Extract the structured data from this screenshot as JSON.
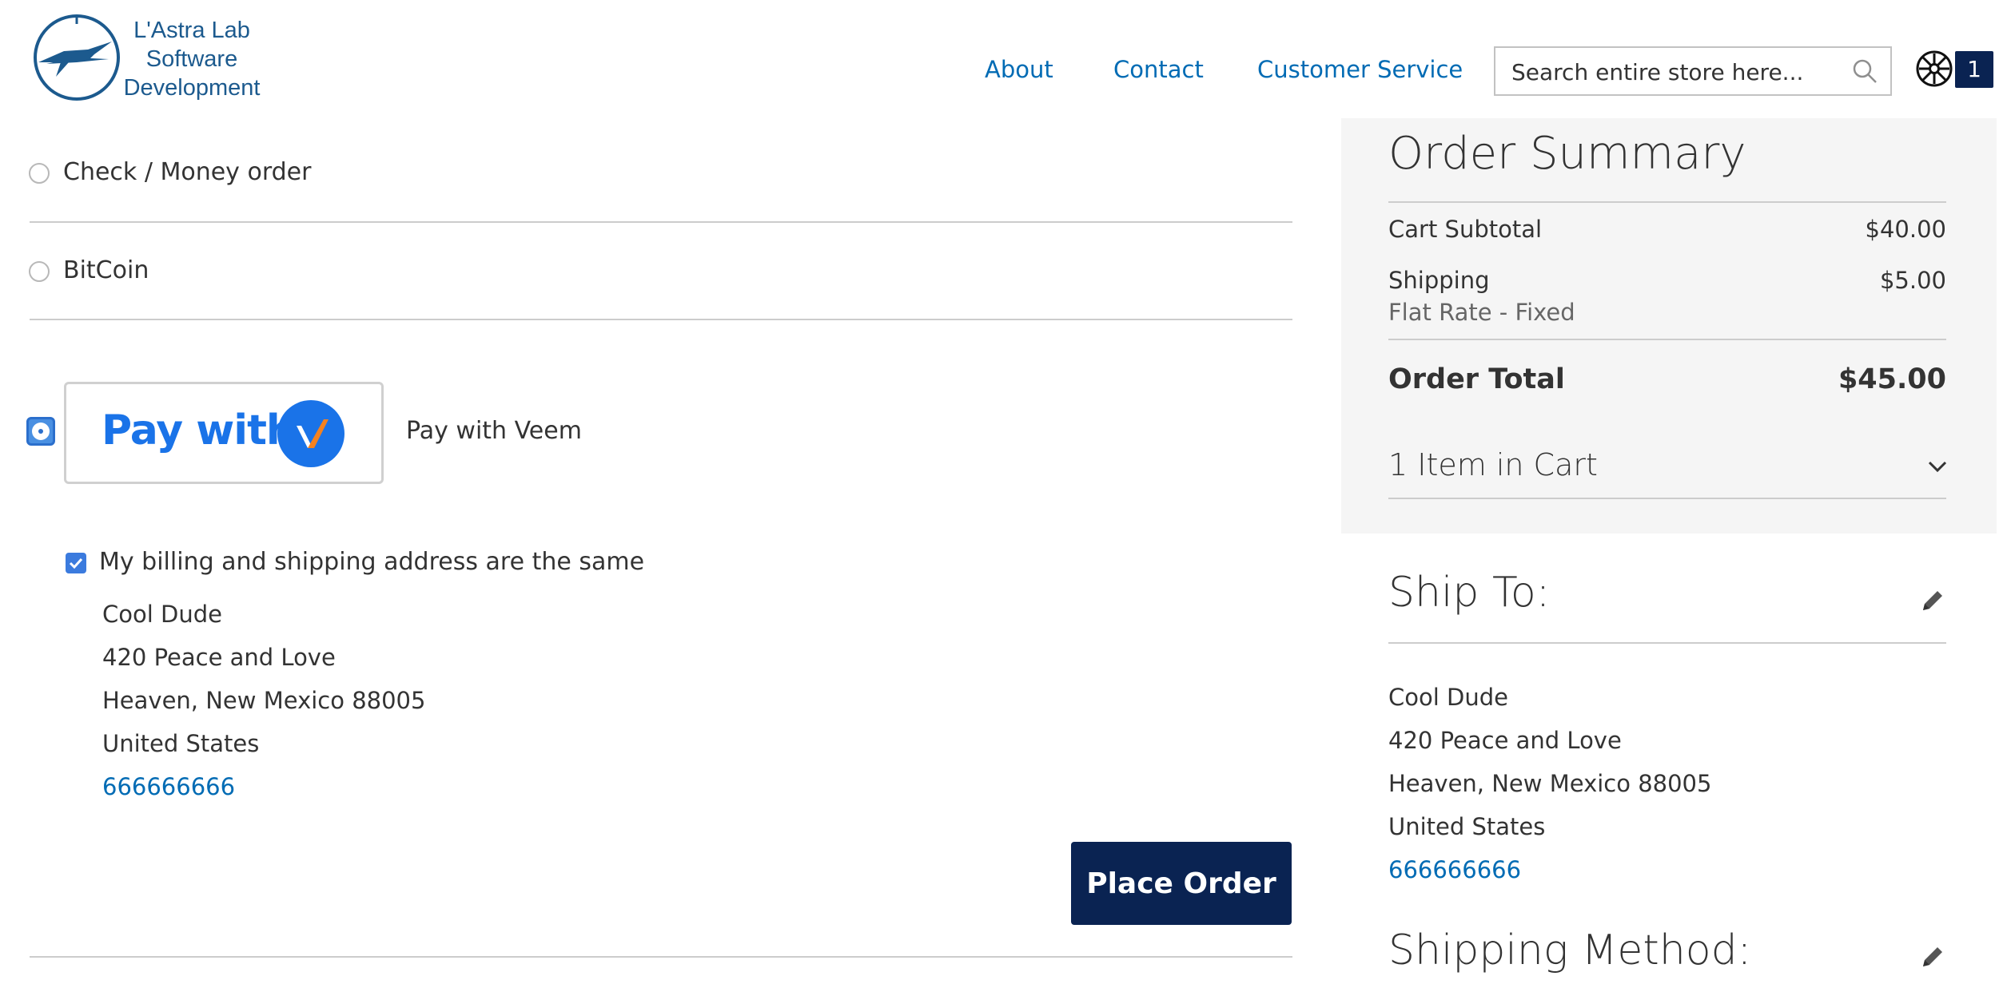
{
  "brand": {
    "line1": "L'Astra Lab",
    "line2": "Software",
    "line3": "Development",
    "color": "#1c5a8e"
  },
  "nav": {
    "items": [
      {
        "label": "About"
      },
      {
        "label": "Contact"
      },
      {
        "label": "Customer Service"
      }
    ]
  },
  "search": {
    "placeholder": "Search entire store here..."
  },
  "cart": {
    "count": "1"
  },
  "payment": {
    "methods": [
      {
        "label": "Check / Money order",
        "selected": false
      },
      {
        "label": "BitCoin",
        "selected": false
      },
      {
        "label": "Pay with Veem",
        "selected": true
      }
    ],
    "veem_logo_text": "Pay with",
    "billing_same_label": "My billing and shipping address are the same",
    "billing_same_checked": true,
    "address": {
      "name": "Cool Dude",
      "street": "420 Peace and Love",
      "city_line": "Heaven, New Mexico 88005",
      "country": "United States",
      "phone": "666666666"
    },
    "place_order_label": "Place Order"
  },
  "summary": {
    "title": "Order Summary",
    "subtotal_label": "Cart Subtotal",
    "subtotal_value": "$40.00",
    "shipping_label": "Shipping",
    "shipping_value": "$5.00",
    "shipping_method": "Flat Rate - Fixed",
    "total_label": "Order Total",
    "total_value": "$45.00",
    "items_label": "1 Item in Cart"
  },
  "ship_to": {
    "title": "Ship To:",
    "name": "Cool Dude",
    "street": "420 Peace and Love",
    "city_line": "Heaven, New Mexico 88005",
    "country": "United States",
    "phone": "666666666"
  },
  "shipping_method": {
    "title": "Shipping Method:"
  },
  "colors": {
    "link": "#006bb4",
    "primary_button": "#0a2352",
    "veem_blue": "#1a73e8",
    "veem_orange": "#f5821f"
  }
}
